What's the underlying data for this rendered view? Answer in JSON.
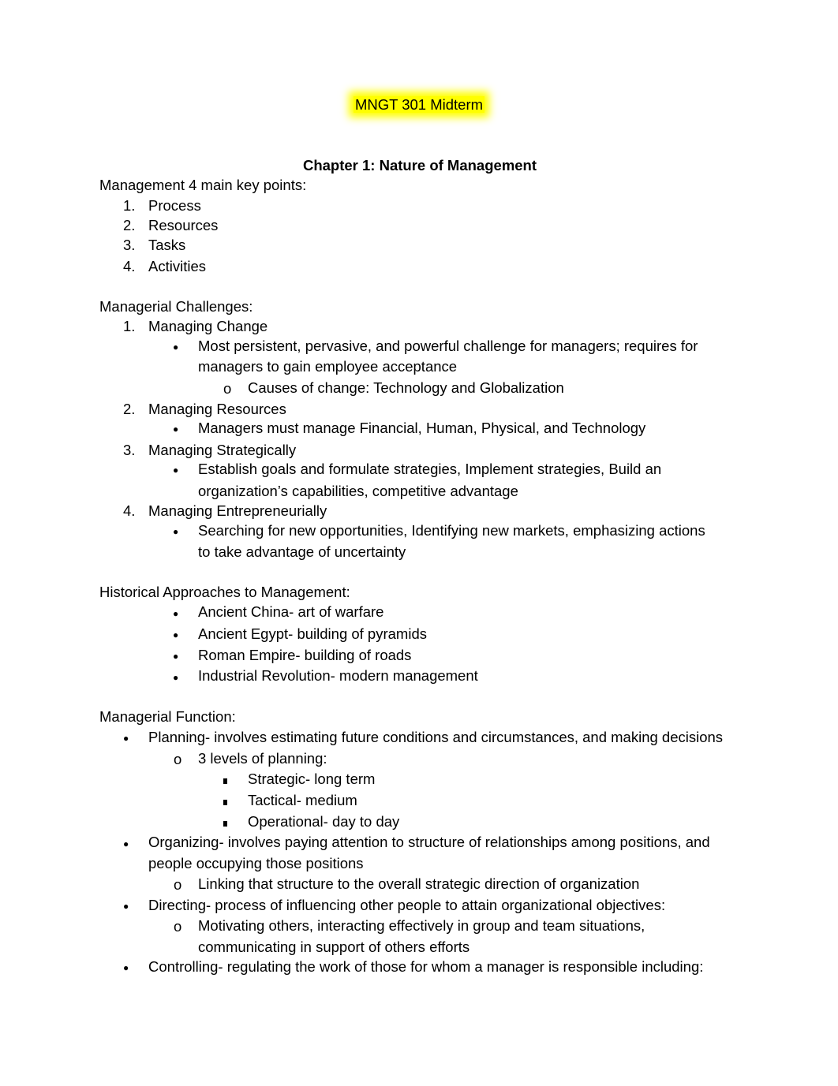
{
  "title": "MNGT 301 Midterm",
  "chapter_heading": "Chapter 1: Nature of Management",
  "sections": {
    "key_points": {
      "heading": "Management 4 main key points:",
      "items": [
        "Process",
        "Resources",
        "Tasks",
        "Activities"
      ]
    },
    "challenges": {
      "heading": "Managerial Challenges:",
      "items": [
        {
          "label": "Managing Change",
          "bullets": [
            {
              "line1": "Most persistent, pervasive, and powerful challenge for managers; requires for",
              "line2": "managers to gain employee acceptance"
            }
          ],
          "sub": [
            "Causes of change: Technology and Globalization"
          ]
        },
        {
          "label": "Managing Resources",
          "bullets": [
            {
              "line1": "Managers must manage Financial, Human, Physical, and Technology"
            }
          ]
        },
        {
          "label": "Managing Strategically",
          "bullets": [
            {
              "line1": "Establish goals and formulate strategies, Implement strategies, Build an",
              "line2": "organization’s capabilities, competitive advantage"
            }
          ]
        },
        {
          "label": "Managing Entrepreneurially",
          "bullets": [
            {
              "line1": "Searching for new opportunities, Identifying new markets, emphasizing actions",
              "line2": "to take advantage of uncertainty"
            }
          ]
        }
      ]
    },
    "historical": {
      "heading": "Historical Approaches to Management:",
      "items": [
        "Ancient China- art of warfare",
        "Ancient Egypt- building of pyramids",
        "Roman Empire- building of roads",
        "Industrial Revolution- modern management"
      ]
    },
    "functions": {
      "heading": "Managerial Function:",
      "planning": {
        "text": "Planning- involves estimating future conditions and circumstances, and making decisions",
        "sub": "3 levels of planning:",
        "levels": [
          "Strategic- long term",
          "Tactical- medium",
          "Operational- day to day"
        ]
      },
      "organizing": {
        "line1": "Organizing- involves paying attention to structure of relationships among positions, and",
        "line2": "people occupying those positions",
        "sub": "Linking that structure to the overall strategic direction of organization"
      },
      "directing": {
        "text": "Directing- process of influencing other people to attain organizational objectives:",
        "sub_line1": "Motivating others, interacting effectively in group and team situations,",
        "sub_line2": "communicating in support of others efforts"
      },
      "controlling": {
        "text": "Controlling- regulating the work of those for whom a manager is responsible including:"
      }
    }
  },
  "markers": {
    "n1": "1.",
    "n2": "2.",
    "n3": "3.",
    "n4": "4.",
    "bullet": "●",
    "circle": "o"
  }
}
